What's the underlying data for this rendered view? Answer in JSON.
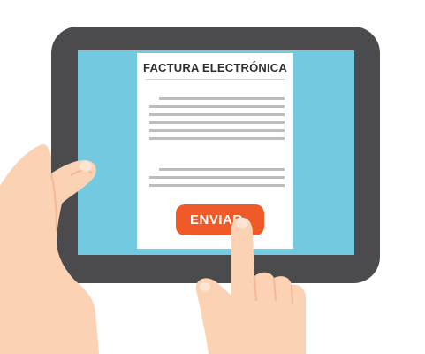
{
  "document": {
    "title": "FACTURA ELECTRÓNICA",
    "send_label": "ENVIAR"
  },
  "colors": {
    "tablet_frame": "#4b4b4d",
    "screen": "#72c9e0",
    "paper": "#ffffff",
    "text_lines": "#bdbdbd",
    "send_button": "#f05a28",
    "skin": "#fcd2b4",
    "skin_shadow": "#f3b895"
  },
  "icons": {
    "left_hand": "hand-holding-icon",
    "right_hand": "pointing-finger-icon"
  }
}
